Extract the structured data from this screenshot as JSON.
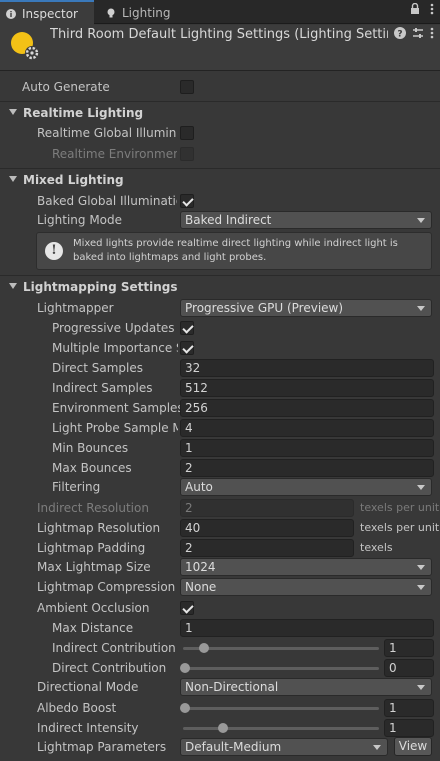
{
  "tabs": {
    "inspector": "Inspector",
    "lighting": "Lighting"
  },
  "header": {
    "title": "Third Room Default Lighting Settings (Lighting Settings)",
    "icon": "lighting-settings-icon"
  },
  "auto_generate": {
    "label": "Auto Generate",
    "checked": false
  },
  "realtime": {
    "title": "Realtime Lighting",
    "gi_label": "Realtime Global Illumination",
    "gi_checked": false,
    "env_label": "Realtime Environment Lighting",
    "env_checked": false
  },
  "mixed": {
    "title": "Mixed Lighting",
    "baked_gi_label": "Baked Global Illumination",
    "baked_gi_checked": true,
    "mode_label": "Lighting Mode",
    "mode_value": "Baked Indirect",
    "help_text": "Mixed lights provide realtime direct lighting while indirect light is baked into lightmaps and light probes."
  },
  "lightmapping": {
    "title": "Lightmapping Settings",
    "lightmapper_label": "Lightmapper",
    "lightmapper_value": "Progressive GPU (Preview)",
    "progressive_updates_label": "Progressive Updates",
    "progressive_updates_checked": true,
    "mis_label": "Multiple Importance Sampling",
    "mis_checked": true,
    "direct_samples_label": "Direct Samples",
    "direct_samples": "32",
    "indirect_samples_label": "Indirect Samples",
    "indirect_samples": "512",
    "env_samples_label": "Environment Samples",
    "env_samples": "256",
    "probe_mult_label": "Light Probe Sample Multiplier",
    "probe_mult": "4",
    "min_bounces_label": "Min Bounces",
    "min_bounces": "1",
    "max_bounces_label": "Max Bounces",
    "max_bounces": "2",
    "filtering_label": "Filtering",
    "filtering_value": "Auto",
    "indirect_res_label": "Indirect Resolution",
    "indirect_res": "2",
    "lightmap_res_label": "Lightmap Resolution",
    "lightmap_res": "40",
    "texels_per_unit": "texels per unit",
    "padding_label": "Lightmap Padding",
    "padding": "2",
    "texels": "texels",
    "max_size_label": "Max Lightmap Size",
    "max_size": "1024",
    "compression_label": "Lightmap Compression",
    "compression": "None",
    "ao_label": "Ambient Occlusion",
    "ao_checked": true,
    "max_distance_label": "Max Distance",
    "max_distance": "1",
    "indirect_contrib_label": "Indirect Contribution",
    "indirect_contrib": "1",
    "direct_contrib_label": "Direct Contribution",
    "direct_contrib": "0",
    "directional_mode_label": "Directional Mode",
    "directional_mode": "Non-Directional",
    "albedo_boost_label": "Albedo Boost",
    "albedo_boost": "1",
    "indirect_intensity_label": "Indirect Intensity",
    "indirect_intensity": "1",
    "params_label": "Lightmap Parameters",
    "params_value": "Default-Medium",
    "view_button": "View"
  },
  "colors": {
    "accent": "#3a79bb",
    "bg": "#383838",
    "field": "#2a2a2a"
  }
}
